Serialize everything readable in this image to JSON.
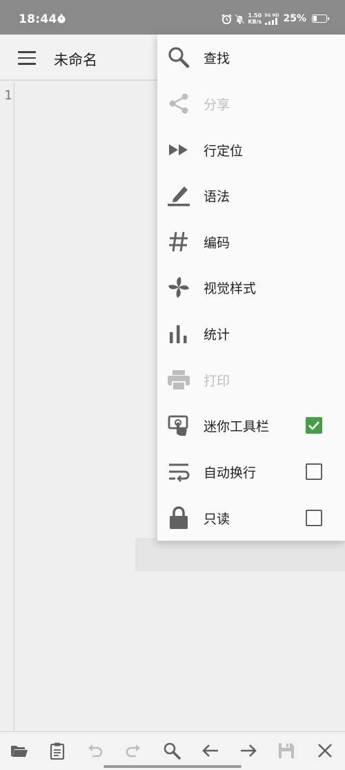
{
  "status_bar": {
    "time": "18:44",
    "net_speed_value": "1.50",
    "net_speed_unit": "KB/s",
    "network": "5G HD",
    "battery_percent": "25%",
    "battery_level": 0.25
  },
  "app_bar": {
    "title": "未命名"
  },
  "editor": {
    "line_numbers": [
      "1"
    ]
  },
  "menu": {
    "items": [
      {
        "label": "查找",
        "icon": "search-icon",
        "disabled": false
      },
      {
        "label": "分享",
        "icon": "share-icon",
        "disabled": true
      },
      {
        "label": "行定位",
        "icon": "fast-forward-icon",
        "disabled": false
      },
      {
        "label": "语法",
        "icon": "highlighter-pen-icon",
        "disabled": false
      },
      {
        "label": "编码",
        "icon": "hash-icon",
        "disabled": false
      },
      {
        "label": "视觉样式",
        "icon": "pinwheel-icon",
        "disabled": false
      },
      {
        "label": "统计",
        "icon": "bar-chart-icon",
        "disabled": false
      },
      {
        "label": "打印",
        "icon": "printer-icon",
        "disabled": true
      },
      {
        "label": "迷你工具栏",
        "icon": "touch-toolbar-icon",
        "disabled": false,
        "checked": true
      },
      {
        "label": "自动换行",
        "icon": "word-wrap-icon",
        "disabled": false,
        "checked": false
      },
      {
        "label": "只读",
        "icon": "lock-icon",
        "disabled": false,
        "checked": false
      }
    ]
  },
  "bottom_toolbar": {
    "tools": [
      "folder-icon",
      "clipboard-icon",
      "undo-icon",
      "redo-icon",
      "search-icon",
      "arrow-left-icon",
      "arrow-right-icon",
      "save-icon",
      "close-icon"
    ]
  },
  "colors": {
    "accent_green": "#43a047",
    "icon_gray": "#616161",
    "disabled_gray": "#bdbdbd",
    "status_bar_bg": "#8a8a8a"
  }
}
